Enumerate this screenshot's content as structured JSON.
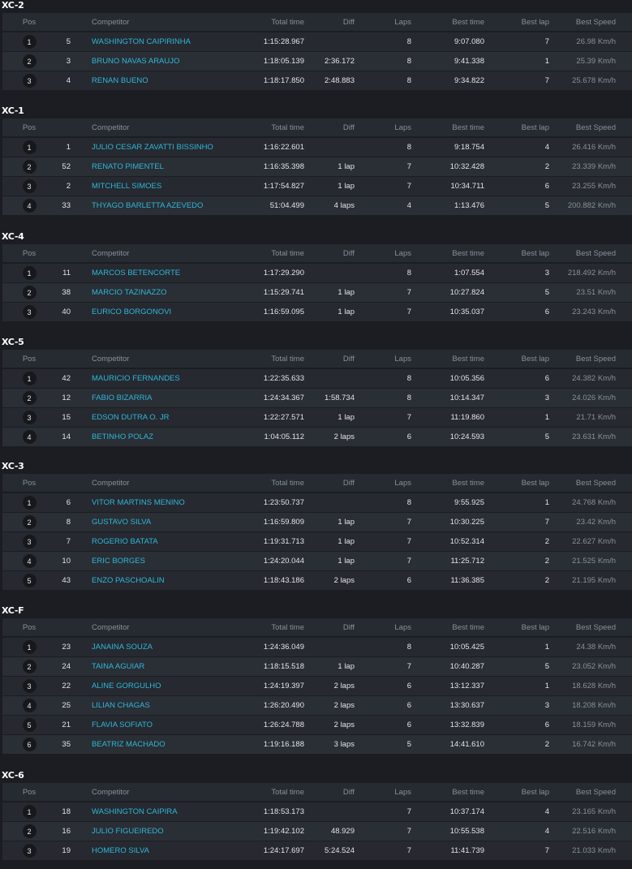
{
  "headers": {
    "pos": "Pos",
    "competitor": "Competitor",
    "total_time": "Total time",
    "diff": "Diff",
    "laps": "Laps",
    "best_time": "Best time",
    "best_lap": "Best lap",
    "best_speed": "Best Speed"
  },
  "categories": [
    {
      "title": "XC-2",
      "rows": [
        {
          "pos": "1",
          "num": "5",
          "name": "WASHINGTON CAIPIRINHA",
          "total": "1:15:28.967",
          "diff": "",
          "laps": "8",
          "best": "9:07.080",
          "bestlap": "7",
          "speed": "26.98 Km/h"
        },
        {
          "pos": "2",
          "num": "3",
          "name": "BRUNO NAVAS ARAUJO",
          "total": "1:18:05.139",
          "diff": "2:36.172",
          "laps": "8",
          "best": "9:41.338",
          "bestlap": "1",
          "speed": "25.39 Km/h"
        },
        {
          "pos": "3",
          "num": "4",
          "name": "RENAN BUENO",
          "total": "1:18:17.850",
          "diff": "2:48.883",
          "laps": "8",
          "best": "9:34.822",
          "bestlap": "7",
          "speed": "25.678 Km/h"
        }
      ]
    },
    {
      "title": "XC-1",
      "rows": [
        {
          "pos": "1",
          "num": "1",
          "name": "JULIO CESAR ZAVATTI BISSINHO",
          "total": "1:16:22.601",
          "diff": "",
          "laps": "8",
          "best": "9:18.754",
          "bestlap": "4",
          "speed": "26.416 Km/h"
        },
        {
          "pos": "2",
          "num": "52",
          "name": "RENATO PIMENTEL",
          "total": "1:16:35.398",
          "diff": "1 lap",
          "laps": "7",
          "best": "10:32.428",
          "bestlap": "2",
          "speed": "23.339 Km/h"
        },
        {
          "pos": "3",
          "num": "2",
          "name": "MITCHELL SIMOES",
          "total": "1:17:54.827",
          "diff": "1 lap",
          "laps": "7",
          "best": "10:34.711",
          "bestlap": "6",
          "speed": "23.255 Km/h"
        },
        {
          "pos": "4",
          "num": "33",
          "name": "THYAGO BARLETTA AZEVEDO",
          "total": "51:04.499",
          "diff": "4 laps",
          "laps": "4",
          "best": "1:13.476",
          "bestlap": "5",
          "speed": "200.882 Km/h"
        }
      ]
    },
    {
      "title": "XC-4",
      "rows": [
        {
          "pos": "1",
          "num": "11",
          "name": "MARCOS BETENCORTE",
          "total": "1:17:29.290",
          "diff": "",
          "laps": "8",
          "best": "1:07.554",
          "bestlap": "3",
          "speed": "218.492 Km/h"
        },
        {
          "pos": "2",
          "num": "38",
          "name": "MARCIO TAZINAZZO",
          "total": "1:15:29.741",
          "diff": "1 lap",
          "laps": "7",
          "best": "10:27.824",
          "bestlap": "5",
          "speed": "23.51 Km/h"
        },
        {
          "pos": "3",
          "num": "40",
          "name": "EURICO BORGONOVI",
          "total": "1:16:59.095",
          "diff": "1 lap",
          "laps": "7",
          "best": "10:35.037",
          "bestlap": "6",
          "speed": "23.243 Km/h"
        }
      ]
    },
    {
      "title": "XC-5",
      "rows": [
        {
          "pos": "1",
          "num": "42",
          "name": "MAURICIO FERNANDES",
          "total": "1:22:35.633",
          "diff": "",
          "laps": "8",
          "best": "10:05.356",
          "bestlap": "6",
          "speed": "24.382 Km/h"
        },
        {
          "pos": "2",
          "num": "12",
          "name": "FABIO BIZARRIA",
          "total": "1:24:34.367",
          "diff": "1:58.734",
          "laps": "8",
          "best": "10:14.347",
          "bestlap": "3",
          "speed": "24.026 Km/h"
        },
        {
          "pos": "3",
          "num": "15",
          "name": "EDSON DUTRA O. JR",
          "total": "1:22:27.571",
          "diff": "1 lap",
          "laps": "7",
          "best": "11:19.860",
          "bestlap": "1",
          "speed": "21.71 Km/h"
        },
        {
          "pos": "4",
          "num": "14",
          "name": "BETINHO POLAZ",
          "total": "1:04:05.112",
          "diff": "2 laps",
          "laps": "6",
          "best": "10:24.593",
          "bestlap": "5",
          "speed": "23.631 Km/h"
        }
      ]
    },
    {
      "title": "XC-3",
      "rows": [
        {
          "pos": "1",
          "num": "6",
          "name": "VITOR MARTINS MENINO",
          "total": "1:23:50.737",
          "diff": "",
          "laps": "8",
          "best": "9:55.925",
          "bestlap": "1",
          "speed": "24.768 Km/h"
        },
        {
          "pos": "2",
          "num": "8",
          "name": "GUSTAVO SILVA",
          "total": "1:16:59.809",
          "diff": "1 lap",
          "laps": "7",
          "best": "10:30.225",
          "bestlap": "7",
          "speed": "23.42 Km/h"
        },
        {
          "pos": "3",
          "num": "7",
          "name": "ROGERIO BATATA",
          "total": "1:19:31.713",
          "diff": "1 lap",
          "laps": "7",
          "best": "10:52.314",
          "bestlap": "2",
          "speed": "22.627 Km/h"
        },
        {
          "pos": "4",
          "num": "10",
          "name": "ERIC BORGES",
          "total": "1:24:20.044",
          "diff": "1 lap",
          "laps": "7",
          "best": "11:25.712",
          "bestlap": "2",
          "speed": "21.525 Km/h"
        },
        {
          "pos": "5",
          "num": "43",
          "name": "ENZO PASCHOALIN",
          "total": "1:18:43.186",
          "diff": "2 laps",
          "laps": "6",
          "best": "11:36.385",
          "bestlap": "2",
          "speed": "21.195 Km/h"
        }
      ]
    },
    {
      "title": "XC-F",
      "rows": [
        {
          "pos": "1",
          "num": "23",
          "name": "JANAINA SOUZA",
          "total": "1:24:36.049",
          "diff": "",
          "laps": "8",
          "best": "10:05.425",
          "bestlap": "1",
          "speed": "24.38 Km/h"
        },
        {
          "pos": "2",
          "num": "24",
          "name": "TAINA AGUIAR",
          "total": "1:18:15.518",
          "diff": "1 lap",
          "laps": "7",
          "best": "10:40.287",
          "bestlap": "5",
          "speed": "23.052 Km/h"
        },
        {
          "pos": "3",
          "num": "22",
          "name": "ALINE GORGULHO",
          "total": "1:24:19.397",
          "diff": "2 laps",
          "laps": "6",
          "best": "13:12.337",
          "bestlap": "1",
          "speed": "18.628 Km/h"
        },
        {
          "pos": "4",
          "num": "25",
          "name": "LILIAN CHAGAS",
          "total": "1:26:20.490",
          "diff": "2 laps",
          "laps": "6",
          "best": "13:30.637",
          "bestlap": "3",
          "speed": "18.208 Km/h"
        },
        {
          "pos": "5",
          "num": "21",
          "name": "FLAVIA SOFIATO",
          "total": "1:26:24.788",
          "diff": "2 laps",
          "laps": "6",
          "best": "13:32.839",
          "bestlap": "6",
          "speed": "18.159 Km/h"
        },
        {
          "pos": "6",
          "num": "35",
          "name": "BEATRIZ MACHADO",
          "total": "1:19:16.188",
          "diff": "3 laps",
          "laps": "5",
          "best": "14:41.610",
          "bestlap": "2",
          "speed": "16.742 Km/h"
        }
      ]
    },
    {
      "title": "XC-6",
      "rows": [
        {
          "pos": "1",
          "num": "18",
          "name": "WASHINGTON CAIPIRA",
          "total": "1:18:53.173",
          "diff": "",
          "laps": "7",
          "best": "10:37.174",
          "bestlap": "4",
          "speed": "23.165 Km/h"
        },
        {
          "pos": "2",
          "num": "16",
          "name": "JULIO FIGUEIREDO",
          "total": "1:19:42.102",
          "diff": "48.929",
          "laps": "7",
          "best": "10:55.538",
          "bestlap": "4",
          "speed": "22.516 Km/h"
        },
        {
          "pos": "3",
          "num": "19",
          "name": "HOMERO SILVA",
          "total": "1:24:17.697",
          "diff": "5:24.524",
          "laps": "7",
          "best": "11:41.739",
          "bestlap": "7",
          "speed": "21.033 Km/h"
        }
      ]
    }
  ]
}
